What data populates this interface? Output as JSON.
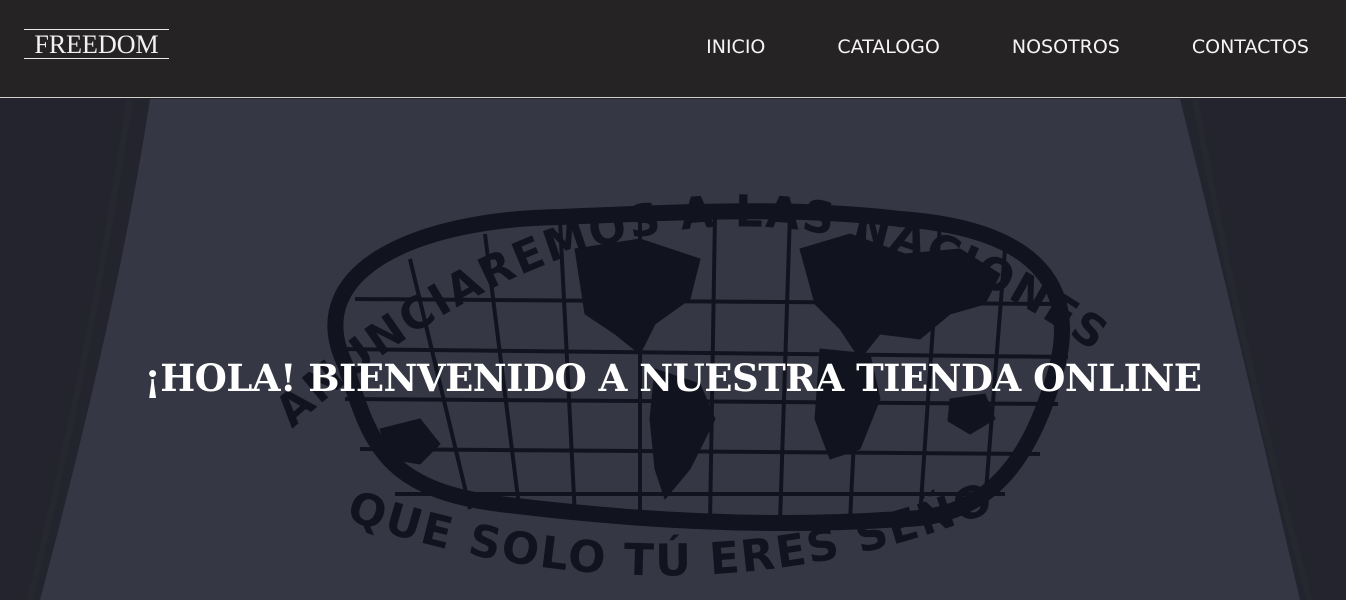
{
  "brand": {
    "logo_text": "FREEDOM"
  },
  "nav": {
    "items": [
      {
        "label": "INICIO"
      },
      {
        "label": "CATALOGO"
      },
      {
        "label": "NOSOTROS"
      },
      {
        "label": "CONTACTOS"
      }
    ]
  },
  "hero": {
    "title": "¡HOLA! BIENVENIDO A NUESTRA TIENDA ONLINE",
    "image": {
      "top_text": "ANUNCIAREMOS A LAS NACIONES",
      "bottom_text": "QUE SOLO TÚ ERES SEÑOR"
    }
  },
  "colors": {
    "navbar_bg": "#262324",
    "nav_text": "#f4f4f4",
    "hero_title": "#ffffff",
    "shirt_print": "#111420"
  }
}
